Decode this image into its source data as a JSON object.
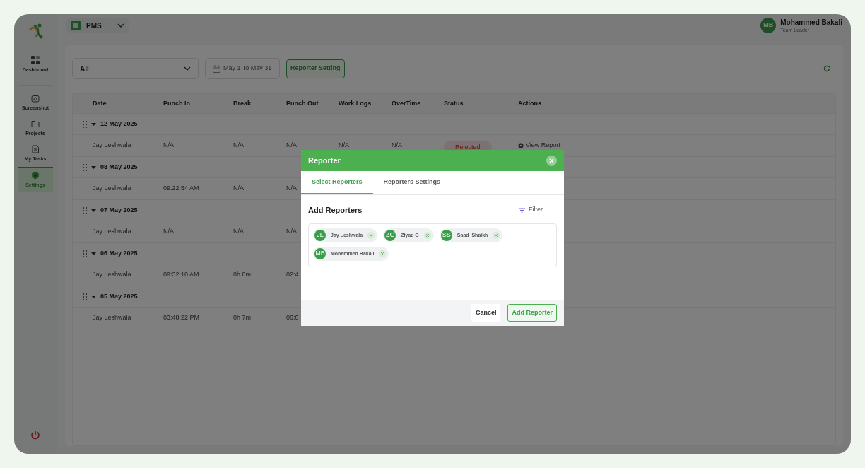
{
  "topbar": {
    "project": "PMS"
  },
  "sidebar": {
    "items": [
      {
        "label": "Dashboard",
        "kind": "grid",
        "selected": false
      },
      {
        "label": "Screenshot",
        "kind": "camera",
        "selected": false
      },
      {
        "label": "Projects",
        "kind": "folder",
        "selected": false
      },
      {
        "label": "My Tasks",
        "kind": "doc",
        "selected": false
      },
      {
        "label": "Settings",
        "kind": "gear",
        "selected": true
      }
    ]
  },
  "user": {
    "initials": "MB",
    "name": "Mohammed Bakali",
    "role": "Team Leader"
  },
  "filters": {
    "select": "All",
    "date_range": "May 1 To May 31",
    "button": "Reporter Setting"
  },
  "table": {
    "columns": [
      "Date",
      "Punch In",
      "Break",
      "Punch Out",
      "Work Logs",
      "OverTime",
      "Status",
      "Actions"
    ],
    "groups": [
      {
        "date": "12 May 2025",
        "expanded": true,
        "rows": [
          {
            "cells": [
              "Jay Leshwala",
              "N/A",
              "N/A",
              "N/A",
              "N/A",
              "N/A"
            ],
            "status": "Rejected",
            "action": "View Report"
          }
        ]
      },
      {
        "date": "08 May 2025",
        "expanded": true,
        "rows": [
          {
            "cells": [
              "Jay Leshwala",
              "09:22:54 AM",
              "N/A",
              "N/A"
            ]
          }
        ]
      },
      {
        "date": "07 May 2025",
        "expanded": true,
        "rows": [
          {
            "cells": [
              "Jay Leshwala",
              "N/A",
              "N/A",
              "N/A"
            ]
          }
        ]
      },
      {
        "date": "06 May 2025",
        "expanded": true,
        "rows": [
          {
            "cells": [
              "Jay Leshwala",
              "09:32:10 AM",
              "0h 0m",
              "02:4"
            ]
          }
        ]
      },
      {
        "date": "05 May 2025",
        "expanded": true,
        "rows": [
          {
            "cells": [
              "Jay Leshwala",
              "03:48:22 PM",
              "0h 7m",
              "06:0"
            ]
          }
        ]
      }
    ]
  },
  "modal": {
    "title": "Reporter",
    "tabs": [
      {
        "label": "Select Reporters",
        "selected": true
      },
      {
        "label": "Reporters Settings",
        "selected": false
      }
    ],
    "section": "Add Reporters",
    "filter": "Filter",
    "reporters": [
      {
        "initials": "JL",
        "name": "Jay Leshwala"
      },
      {
        "initials": "ZG",
        "name": "Ziyad G"
      },
      {
        "initials": "SS",
        "name": "Saad  Shaikh"
      },
      {
        "initials": "MB",
        "name": "Mohammed Bakali"
      }
    ],
    "buttons": {
      "cancel": "Cancel",
      "confirm": "Add Reporter"
    }
  }
}
